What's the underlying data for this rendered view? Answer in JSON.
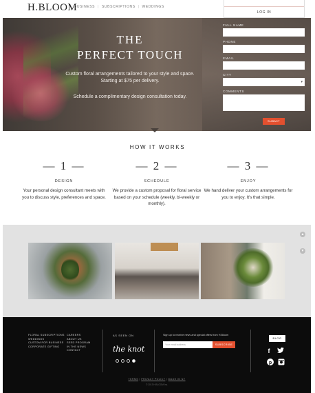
{
  "header": {
    "logo": "H.BLOOM",
    "nav": [
      "BUSINESS",
      "SUBSCRIPTIONS",
      "WEDDINGS"
    ],
    "login_label": "LOG IN"
  },
  "hero": {
    "title_line1": "THE",
    "title_line2": "PERFECT TOUCH",
    "subtitle": "Custom floral arrangements tailored to your style and space. Starting at $75 per delivery.",
    "subtitle2": "Schedule a complimentary design consultation today."
  },
  "form": {
    "full_name_label": "FULL NAME",
    "phone_label": "PHONE",
    "email_label": "EMAIL",
    "city_label": "CITY",
    "comments_label": "COMMENTS",
    "submit_label": "SUBMIT"
  },
  "how": {
    "title": "HOW IT WORKS",
    "steps": [
      {
        "num": "— 1 —",
        "name": "DESIGN",
        "desc": "Your personal design consultant meets with you to discuss style, preferences and space."
      },
      {
        "num": "— 2 —",
        "name": "SCHEDULE",
        "desc": "We provide a custom proposal for floral service based on your schedule (weekly, bi-weekly or monthly)."
      },
      {
        "num": "— 3 —",
        "name": "ENJOY",
        "desc": "We hand deliver your custom arrangements for you to enjoy. It's that simple."
      }
    ]
  },
  "footer": {
    "col1": [
      "FLORAL SUBSCRIPTIONS",
      "WEDDINGS",
      "CUSTOM FOR BUSINESS",
      "CORPORATE GIFTING"
    ],
    "col2": [
      "CAREERS",
      "ABOUT US",
      "SEED PROGRAM",
      "IN THE NEWS",
      "CONTACT"
    ],
    "seen_label": "AS SEEN ON",
    "seen_logo": "the knot",
    "newsletter_label": "Sign up to receive news and special offers from H.Bloom",
    "newsletter_placeholder": "Your email address",
    "subscribe_label": "SUBSCRIBE",
    "blog_label": "BLOG",
    "legal": [
      "TERMS",
      "PRIVACY POLICY",
      "MADE IN NY"
    ],
    "copyright": "© 2013 H.BLOOM Inc."
  },
  "colors": {
    "accent": "#e3502f",
    "footer_bg": "#0c0c0c",
    "gallery_bg": "#e2e2e2"
  },
  "icons": [
    "facebook-icon",
    "twitter-icon",
    "pinterest-icon",
    "instagram-icon",
    "chevron-up-icon",
    "chevron-down-icon"
  ]
}
